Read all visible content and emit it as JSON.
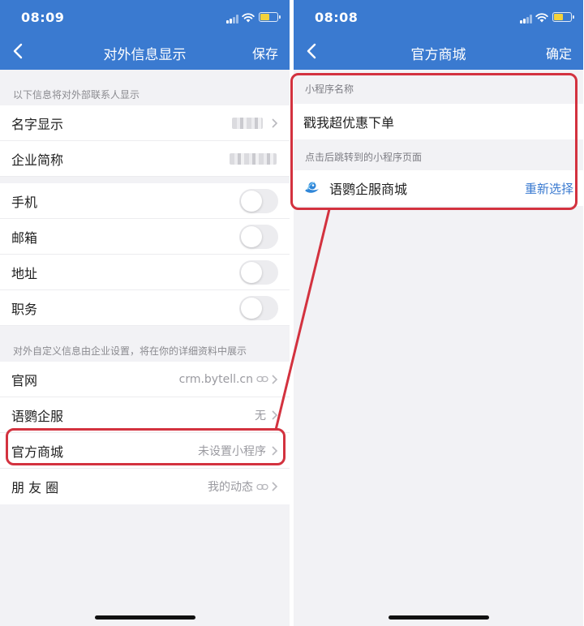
{
  "left": {
    "status_time": "08:09",
    "title": "对外信息显示",
    "action": "保存",
    "section1_note": "以下信息将对外部联系人显示",
    "name_rows": [
      {
        "label": "名字显示"
      },
      {
        "label": "企业简称"
      }
    ],
    "toggle_rows": [
      {
        "label": "手机"
      },
      {
        "label": "邮箱"
      },
      {
        "label": "地址"
      },
      {
        "label": "职务"
      }
    ],
    "section2_note": "对外自定义信息由企业设置，将在你的详细资料中展示",
    "custom_rows": [
      {
        "label": "官网",
        "value": "crm.bytell.cn"
      },
      {
        "label": "语鹦企服",
        "value": "无"
      },
      {
        "label": "官方商城",
        "value": "未设置小程序"
      },
      {
        "label": "朋 友 圈",
        "value": "我的动态"
      }
    ]
  },
  "right": {
    "status_time": "08:08",
    "title": "官方商城",
    "action": "确定",
    "name_section_label": "小程序名称",
    "mini_program_name": "戳我超优惠下单",
    "page_section_label": "点击后跳转到的小程序页面",
    "selected_app": "语鹦企服商城",
    "reselect": "重新选择"
  },
  "colors": {
    "header": "#3a7ad0",
    "highlight": "#d3323f",
    "link": "#3a7ad0"
  },
  "icons": [
    "back-arrow-icon",
    "signal-icon",
    "wifi-icon",
    "battery-icon",
    "chevron-right-icon",
    "link-icon",
    "mini-program-logo-icon"
  ]
}
